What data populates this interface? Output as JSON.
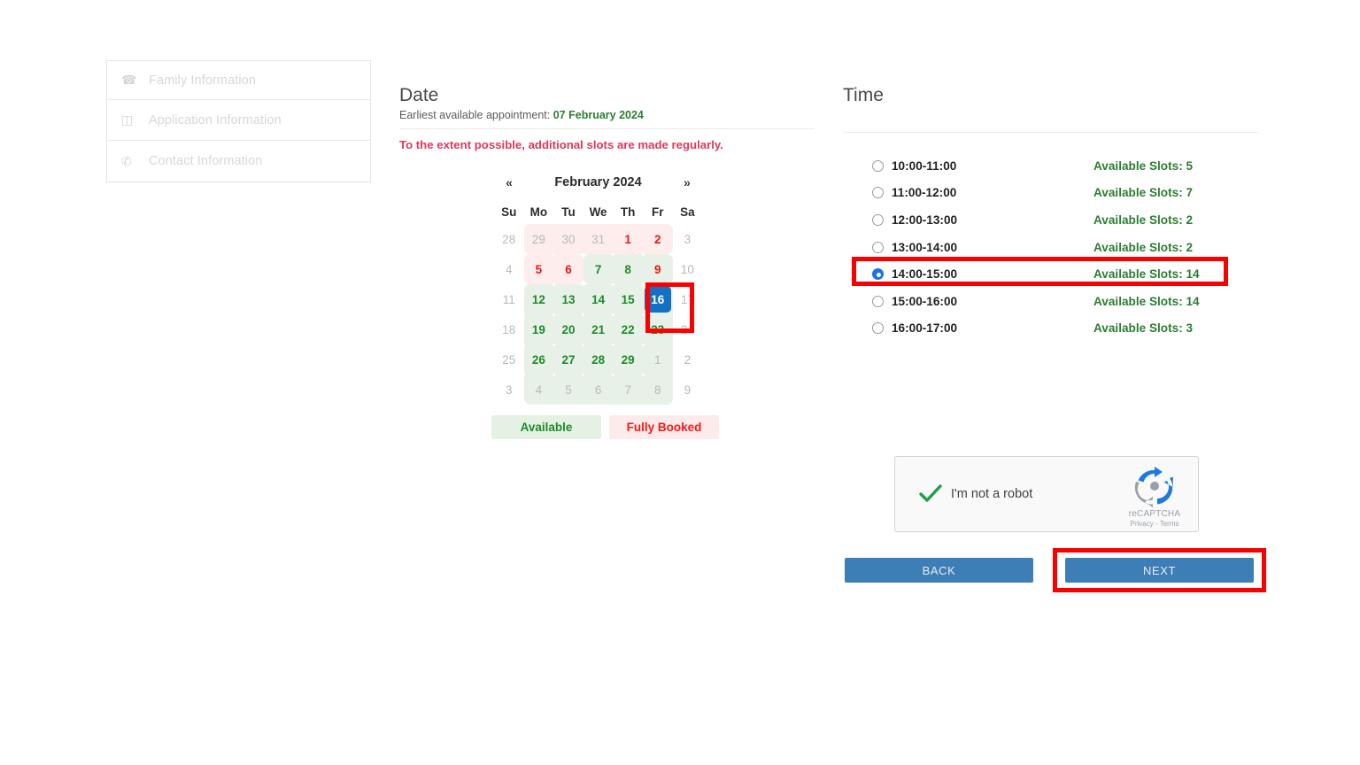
{
  "sidebar": {
    "items": [
      {
        "label": "Family Information",
        "icon": "telephone-icon"
      },
      {
        "label": "Application Information",
        "icon": "card-list-icon"
      },
      {
        "label": "Contact Information",
        "icon": "phone-handset-icon"
      }
    ]
  },
  "date_section": {
    "title": "Date",
    "earliest_prefix": "Earliest available appointment:",
    "earliest_date": "07 February 2024",
    "notice": "To the extent possible, additional slots are made regularly."
  },
  "calendar": {
    "prev_label": "«",
    "next_label": "»",
    "month_title": "February 2024",
    "weekdays": [
      "Su",
      "Mo",
      "Tu",
      "We",
      "Th",
      "Fr",
      "Sa"
    ],
    "selected_day": "16",
    "weeks": [
      [
        {
          "d": "28",
          "state": "muted"
        },
        {
          "d": "29",
          "state": "muted"
        },
        {
          "d": "30",
          "state": "muted"
        },
        {
          "d": "31",
          "state": "muted"
        },
        {
          "d": "1",
          "state": "booked"
        },
        {
          "d": "2",
          "state": "booked"
        },
        {
          "d": "3",
          "state": "muted"
        }
      ],
      [
        {
          "d": "4",
          "state": "muted"
        },
        {
          "d": "5",
          "state": "booked"
        },
        {
          "d": "6",
          "state": "booked"
        },
        {
          "d": "7",
          "state": "available"
        },
        {
          "d": "8",
          "state": "available"
        },
        {
          "d": "9",
          "state": "booked"
        },
        {
          "d": "10",
          "state": "muted"
        }
      ],
      [
        {
          "d": "11",
          "state": "muted"
        },
        {
          "d": "12",
          "state": "available"
        },
        {
          "d": "13",
          "state": "available"
        },
        {
          "d": "14",
          "state": "available"
        },
        {
          "d": "15",
          "state": "available"
        },
        {
          "d": "16",
          "state": "selected"
        },
        {
          "d": "17",
          "state": "muted"
        }
      ],
      [
        {
          "d": "18",
          "state": "muted"
        },
        {
          "d": "19",
          "state": "available"
        },
        {
          "d": "20",
          "state": "available"
        },
        {
          "d": "21",
          "state": "available"
        },
        {
          "d": "22",
          "state": "available"
        },
        {
          "d": "23",
          "state": "available"
        },
        {
          "d": "24",
          "state": "muted"
        }
      ],
      [
        {
          "d": "25",
          "state": "muted"
        },
        {
          "d": "26",
          "state": "available"
        },
        {
          "d": "27",
          "state": "available"
        },
        {
          "d": "28",
          "state": "available"
        },
        {
          "d": "29",
          "state": "available"
        },
        {
          "d": "1",
          "state": "muted"
        },
        {
          "d": "2",
          "state": "muted"
        }
      ],
      [
        {
          "d": "3",
          "state": "muted"
        },
        {
          "d": "4",
          "state": "muted"
        },
        {
          "d": "5",
          "state": "muted"
        },
        {
          "d": "6",
          "state": "muted"
        },
        {
          "d": "7",
          "state": "muted"
        },
        {
          "d": "8",
          "state": "muted"
        },
        {
          "d": "9",
          "state": "muted"
        }
      ]
    ],
    "legend": {
      "available": "Available",
      "fully_booked": "Fully Booked"
    }
  },
  "time_section": {
    "title": "Time",
    "slots": [
      {
        "label": "10:00-11:00",
        "availability": "Available Slots: 5",
        "selected": false
      },
      {
        "label": "11:00-12:00",
        "availability": "Available Slots: 7",
        "selected": false
      },
      {
        "label": "12:00-13:00",
        "availability": "Available Slots: 2",
        "selected": false
      },
      {
        "label": "13:00-14:00",
        "availability": "Available Slots: 2",
        "selected": false
      },
      {
        "label": "14:00-15:00",
        "availability": "Available Slots: 14",
        "selected": true
      },
      {
        "label": "15:00-16:00",
        "availability": "Available Slots: 14",
        "selected": false
      },
      {
        "label": "16:00-17:00",
        "availability": "Available Slots: 3",
        "selected": false
      }
    ]
  },
  "recaptcha": {
    "label": "I'm not a robot",
    "brand": "reCAPTCHA",
    "links": "Privacy - Terms",
    "checked": true
  },
  "actions": {
    "back_label": "BACK",
    "next_label": "NEXT"
  },
  "colors": {
    "accent_blue": "#1370c4",
    "button_blue": "#3c7eb5",
    "available_green": "#1f8a2a",
    "booked_red": "#f01414",
    "notice_red": "#e0385a",
    "highlight_red": "#fb0000",
    "available_bg": "#e8f1e7",
    "booked_bg": "#fdeded"
  }
}
